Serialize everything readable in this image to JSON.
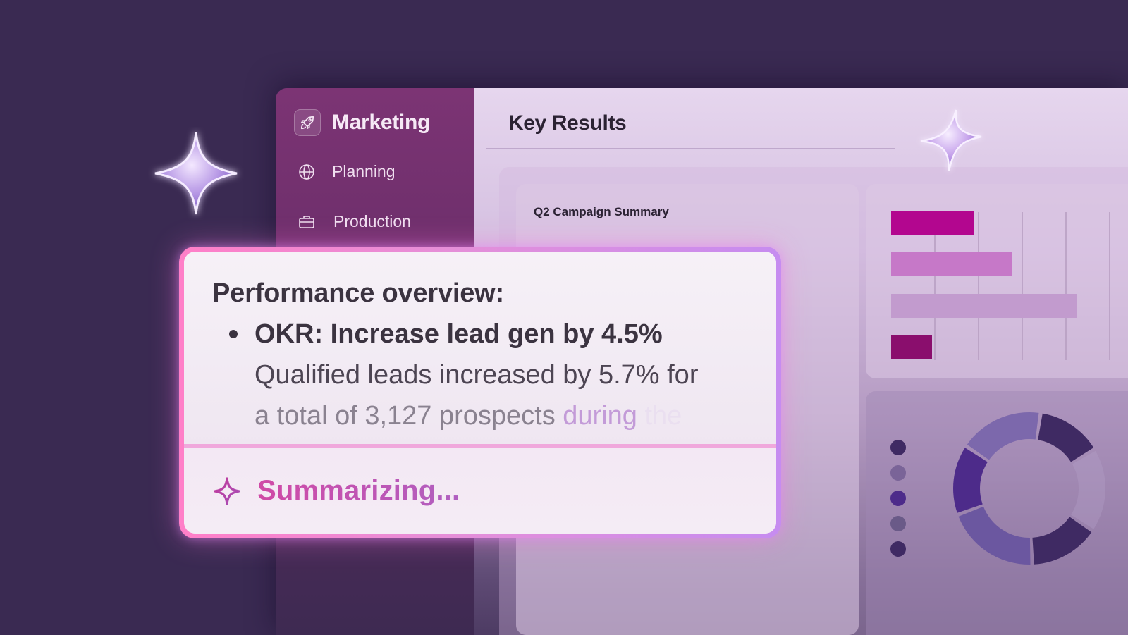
{
  "sidebar": {
    "title": "Marketing",
    "brand_icon": "rocket-icon",
    "items": [
      {
        "label": "Planning",
        "icon": "globe-icon"
      },
      {
        "label": "Production",
        "icon": "briefcase-icon"
      }
    ]
  },
  "main": {
    "title": "Key Results",
    "campaign_card": {
      "title": "Q2 Campaign Summary"
    }
  },
  "popup": {
    "heading": "Performance overview:",
    "bullet": {
      "okr": "OKR: Increase lead gen by 4.5%",
      "detail_line1": "Qualified leads increased by 5.7% for",
      "detail_line2_a": "a total of 3,127 prospects",
      "detail_line2_b": " during",
      "detail_line2_c": " the"
    },
    "status": "Summarizing...",
    "status_icon": "sparkle-icon"
  },
  "colors": {
    "background": "#3a2a52",
    "sidebar": "#7c3474",
    "accent_pink": "#d04aa6",
    "accent_purple": "#b05fc0",
    "bar_magenta": "#b3068f",
    "bar_pink": "#c678c8",
    "bar_lilac": "#c29bce",
    "bar_dark": "#8a0e6d",
    "donut_dark": "#3f2a63",
    "donut_violet": "#4d2b8a",
    "donut_mid": "#6b57a0"
  },
  "chart_data": [
    {
      "type": "bar",
      "orientation": "horizontal",
      "values": [
        0.45,
        0.65,
        1.0,
        0.22
      ]
    },
    {
      "type": "pie",
      "values": [
        0.14,
        0.18,
        0.15,
        0.2,
        0.15,
        0.18
      ]
    }
  ]
}
